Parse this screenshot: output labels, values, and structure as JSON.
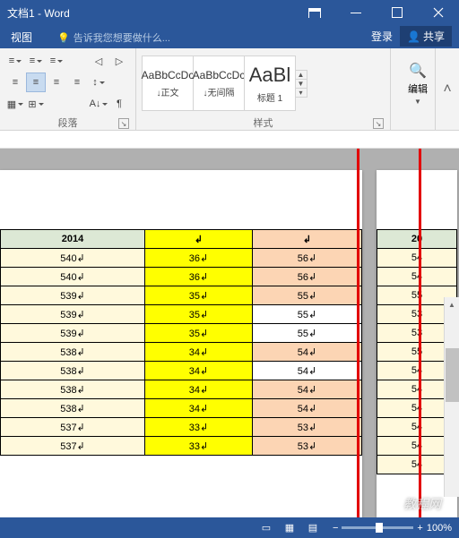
{
  "title_suffix": " - Word",
  "doc_name": "文档1",
  "tab_view": "视图",
  "tell_me": "告诉我您想要做什么...",
  "login": "登录",
  "share": "共享",
  "ribbon": {
    "paragraph_label": "段落",
    "styles_label": "样式",
    "edit_label": "编辑",
    "style_preview": "AaBbCcDc",
    "style_preview_big": "AaBl",
    "style1": "↓正文",
    "style2": "↓无间隔",
    "style3": "标题 1"
  },
  "chart_data": {
    "type": "table",
    "main": {
      "header": "2014",
      "col0": [
        "540",
        "540",
        "539",
        "539",
        "539",
        "538",
        "538",
        "538",
        "538",
        "537",
        "537"
      ],
      "col1": [
        "36",
        "36",
        "35",
        "35",
        "35",
        "34",
        "34",
        "34",
        "34",
        "33",
        "33"
      ],
      "col2": [
        "56",
        "56",
        "55",
        "55",
        "55",
        "54",
        "54",
        "54",
        "54",
        "53",
        "53"
      ]
    },
    "side": {
      "header": "20",
      "col0": [
        "54",
        "54",
        "55",
        "53",
        "53",
        "55",
        "54",
        "54",
        "54",
        "54",
        "54",
        "54"
      ]
    }
  },
  "status": {
    "zoom": "100%"
  },
  "watermark": "教程网"
}
